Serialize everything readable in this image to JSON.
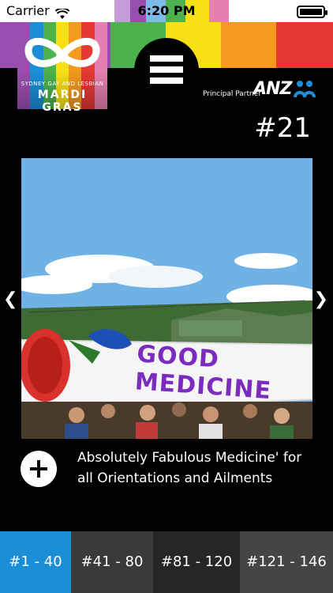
{
  "status_bar": {
    "carrier": "Carrier",
    "time": "6:20 PM"
  },
  "colors": {
    "purple": "#9a4fb0",
    "lavender": "#c79ad8",
    "red": "#e53935",
    "orange": "#f39a1f",
    "yellow": "#f7e017",
    "green": "#4bb24d",
    "blue": "#1a8fd8",
    "pink": "#e77fb0"
  },
  "logo": {
    "line1": "SYDNEY GAY AND LESBIAN",
    "line2": "MARDI GRAS"
  },
  "sponsor": {
    "label": "Principal Partner",
    "brand": "ANZ"
  },
  "gallery": {
    "number": "#21",
    "caption": "Absolutely Fabulous Medicine' for all Orientations and Ailments",
    "banner_text": "GOOD MEDICINE"
  },
  "tabs": [
    {
      "label": "#1 - 40"
    },
    {
      "label": "#41 - 80"
    },
    {
      "label": "#81 - 120"
    },
    {
      "label": "#121 - 146"
    }
  ],
  "icons": {
    "menu": "hamburger-icon",
    "prev": "chevron-left-icon",
    "next": "chevron-right-icon",
    "add": "plus-icon",
    "wifi": "wifi-icon",
    "battery": "battery-icon"
  }
}
